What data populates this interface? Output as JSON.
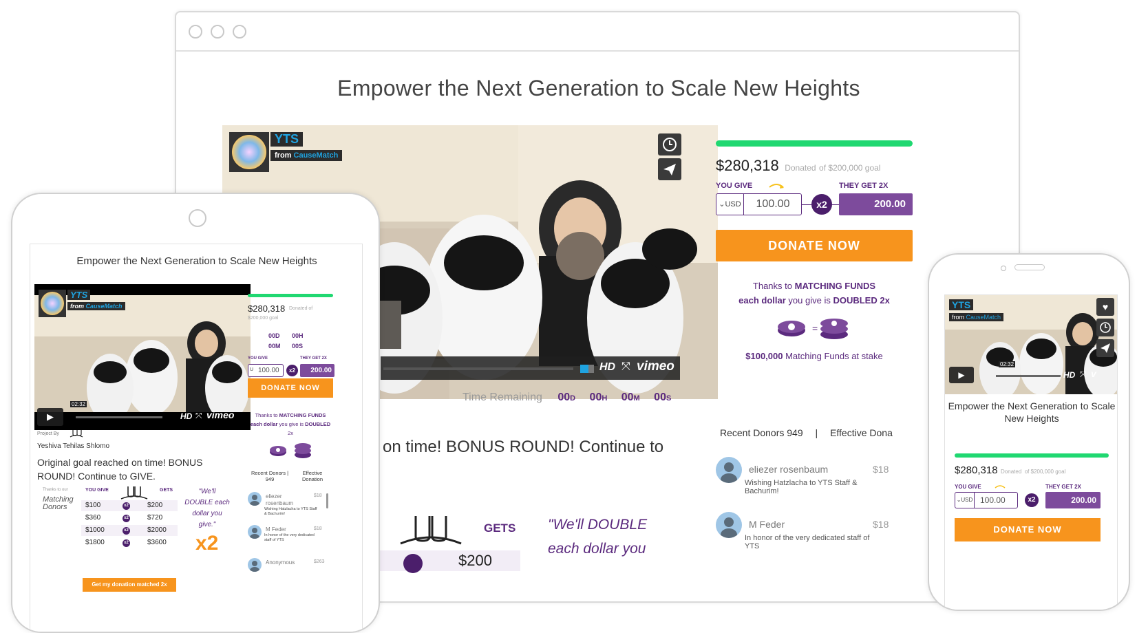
{
  "desktop": {
    "title": "Empower the Next Generation to Scale New Heights",
    "video": {
      "org": "YTS",
      "from": "from",
      "brand": "CauseMatch",
      "hd": "HD",
      "vimeo": "vimeo"
    },
    "time_remaining": {
      "label": "Time Remaining",
      "d": "00",
      "h": "00",
      "m": "00",
      "s": "00",
      "d_unit": "D",
      "h_unit": "H",
      "m_unit": "M",
      "s_unit": "S"
    },
    "donated": {
      "amount": "$280,318",
      "label": "Donated",
      "goal": "of $200,000 goal",
      "progress_percent": 100
    },
    "give": {
      "you_give": "YOU GIVE",
      "they_get": "THEY GET 2X",
      "currency": "USD",
      "amount": "100.00",
      "multiplier": "x2",
      "result": "200.00"
    },
    "donate_label": "DONATE NOW",
    "matching": {
      "line1_pre": "Thanks to ",
      "line1_bold": "MATCHING FUNDS",
      "line2_bold1": "each dollar",
      "line2_mid": " you give is ",
      "line2_bold2": "DOUBLED 2x",
      "eq": "=",
      "stake_amount": "$100,000",
      "stake_label": " Matching Funds at stake"
    },
    "tabs": {
      "recent": "Recent Donors 949",
      "sep": "|",
      "effective": "Effective Dona"
    },
    "donors": [
      {
        "name": "eliezer rosenbaum",
        "amount": "$18",
        "message": "Wishing Hatzlacha to YTS Staff & Bachurim!"
      },
      {
        "name": "M Feder",
        "amount": "$18",
        "message": "In honor of the very dedicated staff of YTS"
      }
    ],
    "bonus_text": "d on time! BONUS ROUND! Continue to",
    "gets": "GETS",
    "quote_line1": "\"We'll DOUBLE",
    "quote_line2": "each dollar you",
    "partial_amount": "$200"
  },
  "tablet": {
    "title": "Empower the Next Generation to Scale New Heights",
    "video": {
      "org": "YTS",
      "from": "from",
      "brand": "CauseMatch",
      "time": "02:32",
      "hd": "HD",
      "vimeo": "vimeo"
    },
    "donated": {
      "amount": "$280,318",
      "label": "Donated of",
      "goal": "$200,000 goal",
      "progress_percent": 100
    },
    "countdown": [
      "00D",
      "00H",
      "00M",
      "00S"
    ],
    "give": {
      "you_give": "YOU GIVE",
      "they_get": "THEY GET 2X",
      "currency": "U",
      "amount": "100.00",
      "multiplier": "x2",
      "result": "200.00"
    },
    "donate_label": "DONATE NOW",
    "matching": {
      "pre": "Thanks to ",
      "bold1": "MATCHING FUNDS",
      "bold2": "each dollar",
      "mid": " you give is ",
      "bold3": "DOUBLED",
      "end": "2x"
    },
    "project_by": "Project By",
    "org_name": "Yeshiva Tehilas Shlomo",
    "bonus": "Original goal reached on time! BONUS ROUND! Continue to GIVE.",
    "matching_table": {
      "thanks": "Thanks to our",
      "donors_label": "Matching Donors",
      "you_give": "YOU GIVE",
      "gets": "GETS",
      "rows": [
        {
          "give": "$100",
          "mult": "x2",
          "get": "$200"
        },
        {
          "give": "$360",
          "mult": "x2",
          "get": "$720"
        },
        {
          "give": "$1000",
          "mult": "x2",
          "get": "$2000"
        },
        {
          "give": "$1800",
          "mult": "x2",
          "get": "$3600"
        }
      ],
      "quote": "\"We'll DOUBLE each dollar you give.\"",
      "big_x2": "x2",
      "cta": "Get my donation matched 2x"
    },
    "tabs": {
      "recent": "Recent Donors | 949",
      "effective": "Effective Donation"
    },
    "donors": [
      {
        "name": "eliezer rosenbaum",
        "amount": "$18",
        "message": "Wishing Hatzlacha to YTS Staff & Bachurim!"
      },
      {
        "name": "M Feder",
        "amount": "$18",
        "message": "In honor of the very dedicated staff of YTS"
      },
      {
        "name": "Anonymous",
        "amount": "$263",
        "message": ""
      }
    ]
  },
  "phone": {
    "video": {
      "org": "YTS",
      "from": "from",
      "brand": "CauseMatch",
      "time": "02:32",
      "hd": "HD"
    },
    "title": "Empower the Next Generation to Scale New Heights",
    "donated": {
      "amount": "$280,318",
      "label": "Donated",
      "goal": "of $200,000 goal",
      "progress_percent": 100
    },
    "give": {
      "you_give": "YOU GIVE",
      "they_get": "THEY GET 2X",
      "currency": "USD",
      "amount": "100.00",
      "multiplier": "x2",
      "result": "200.00"
    },
    "donate_label": "DONATE NOW"
  },
  "colors": {
    "accent": "#f7941d",
    "brand": "#5b2a7e",
    "progress": "#20d871",
    "causematch": "#1fa3e0"
  }
}
